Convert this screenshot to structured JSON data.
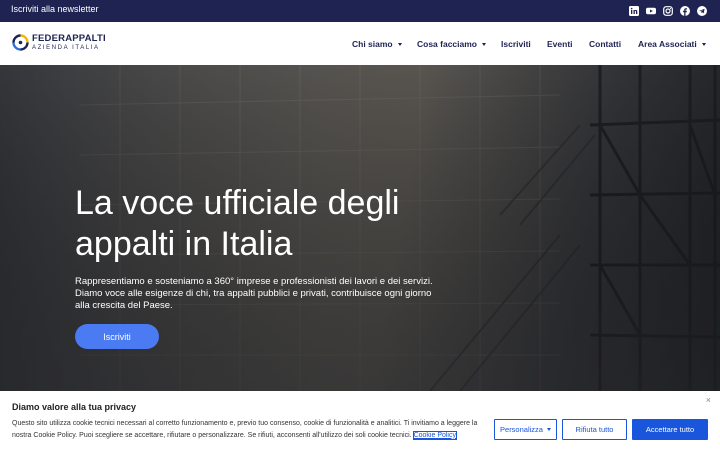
{
  "topbar": {
    "newsletter_label": "Iscriviti alla newsletter",
    "social": [
      "linkedin-icon",
      "youtube-icon",
      "instagram-icon",
      "facebook-icon",
      "telegram-icon"
    ]
  },
  "header": {
    "logo_name": "FEDERAPPALTI",
    "logo_sub": "AZIENDA ITALIA",
    "nav": [
      {
        "label": "Chi siamo",
        "dropdown": true
      },
      {
        "label": "Cosa facciamo",
        "dropdown": true
      },
      {
        "label": "Iscriviti",
        "dropdown": false
      },
      {
        "label": "Eventi",
        "dropdown": false
      },
      {
        "label": "Contatti",
        "dropdown": false
      },
      {
        "label": "Area Associati",
        "dropdown": true
      }
    ]
  },
  "hero": {
    "title": "La voce ufficiale degli appalti in Italia",
    "text": "Rappresentiamo e sosteniamo a 360° imprese e professionisti dei lavori e dei servizi. Diamo voce alle esigenze di chi, tra appalti pubblici e privati, contribuisce ogni giorno alla crescita del Paese.",
    "button_label": "Iscriviti"
  },
  "cookie": {
    "title": "Diamo valore alla tua privacy",
    "close": "×",
    "text": "Questo sito utilizza cookie tecnici necessari al corretto funzionamento e, previo tuo consenso, cookie di funzionalità e analitici. Ti invitiamo a leggere la nostra Cookie Policy. Puoi scegliere se accettare, rifiutare o personalizzare. Se rifiuti, acconsenti all'utilizzo dei soli cookie tecnici.",
    "link_label": "Cookie Policy",
    "personalizza_label": "Personalizza",
    "rifiuta_label": "Rifiuta tutto",
    "accetta_label": "Accettare tutto"
  },
  "colors": {
    "brand_navy": "#1e2352",
    "accent_blue": "#4a7bf2",
    "cookie_blue": "#1a56db"
  }
}
